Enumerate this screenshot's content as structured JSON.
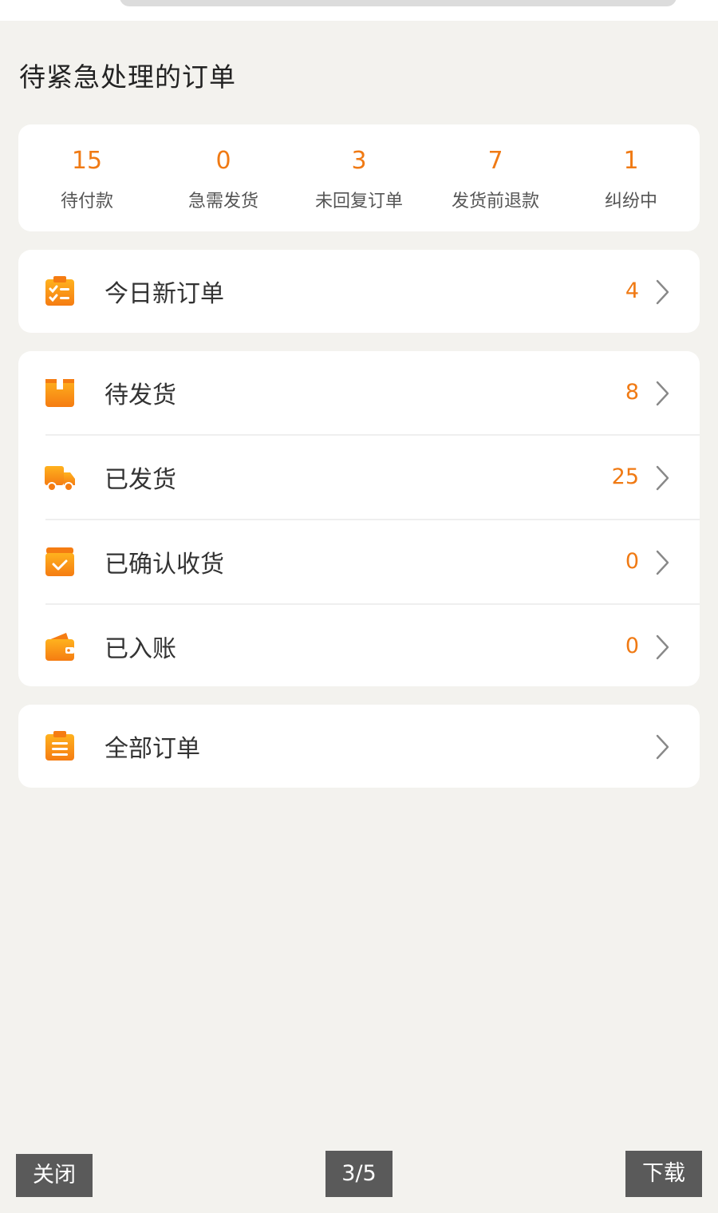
{
  "urgent": {
    "title": "待紧急处理的订单",
    "stats": [
      {
        "value": "15",
        "label": "待付款"
      },
      {
        "value": "0",
        "label": "急需发货"
      },
      {
        "value": "3",
        "label": "未回复订单"
      },
      {
        "value": "7",
        "label": "发货前退款"
      },
      {
        "value": "1",
        "label": "纠纷中"
      }
    ]
  },
  "today": {
    "label": "今日新订单",
    "count": "4",
    "icon": "clipboard-check-icon"
  },
  "orders": [
    {
      "label": "待发货",
      "count": "8",
      "icon": "box-icon"
    },
    {
      "label": "已发货",
      "count": "25",
      "icon": "truck-icon"
    },
    {
      "label": "已确认收货",
      "count": "0",
      "icon": "box-check-icon"
    },
    {
      "label": "已入账",
      "count": "0",
      "icon": "wallet-icon"
    }
  ],
  "all_orders": {
    "label": "全部订单",
    "icon": "clipboard-list-icon"
  },
  "footer": {
    "close_label": "关闭",
    "page_indicator": "3/5",
    "download_label": "下载"
  },
  "colors": {
    "accent": "#f07a14",
    "icon_orange": "#f7a21b",
    "background": "#f3f2ee",
    "footer_button": "#5a5a5a"
  }
}
